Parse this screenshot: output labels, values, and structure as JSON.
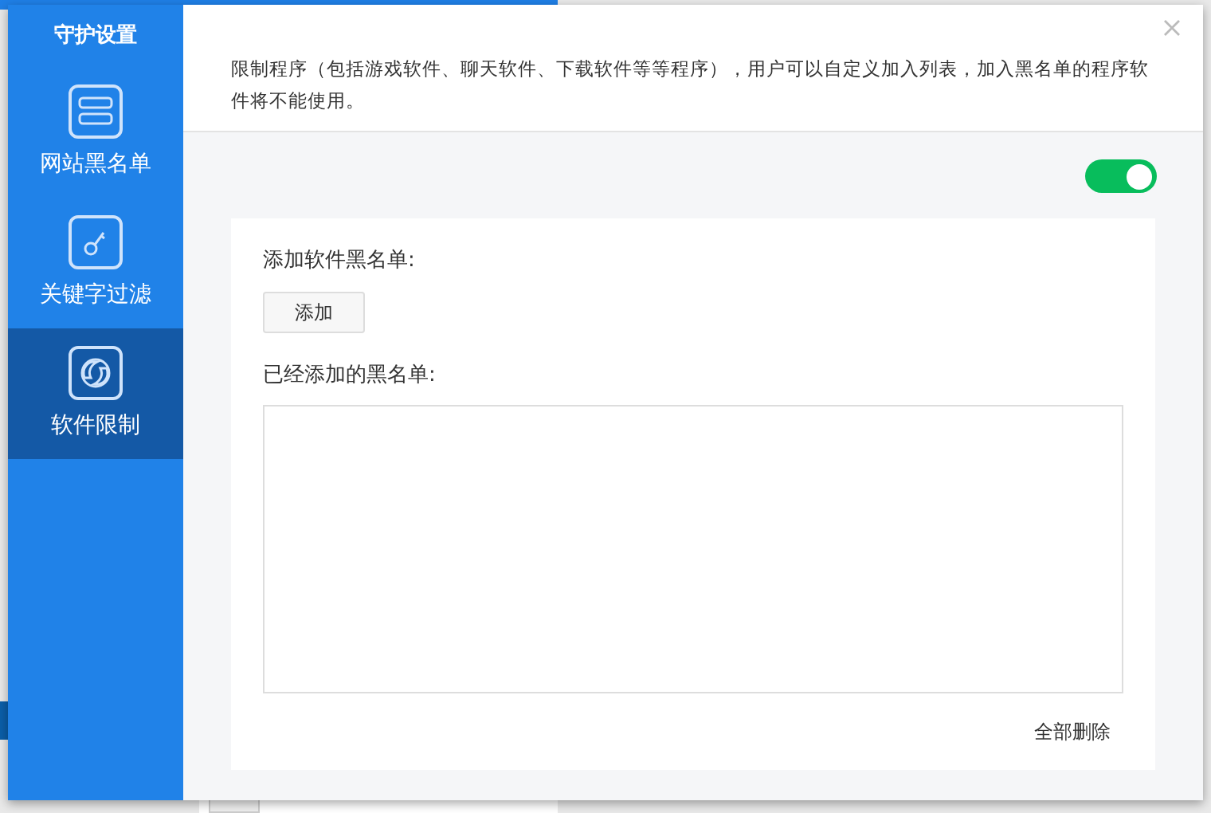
{
  "sidebar": {
    "title": "守护设置",
    "items": [
      {
        "kind": "list",
        "label": "网站黑名单",
        "selected": false
      },
      {
        "kind": "key",
        "label": "关键字过滤",
        "selected": false
      },
      {
        "kind": "swirl",
        "label": "软件限制",
        "selected": true
      }
    ]
  },
  "description": "限制程序（包括游戏软件、聊天软件、下载软件等等程序），用户可以自定义加入列表，加入黑名单的程序软件将不能使用。",
  "toggle": {
    "on": true
  },
  "add_label": "添加软件黑名单:",
  "add_button": "添加",
  "list_label": "已经添加的黑名单:",
  "delete_all_button": "全部删除"
}
